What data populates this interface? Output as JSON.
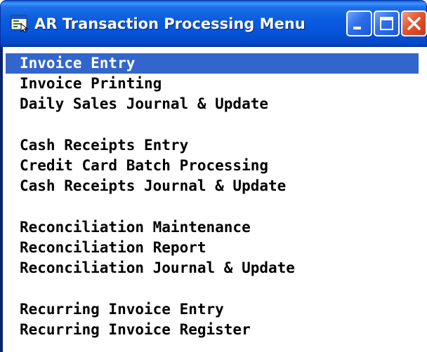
{
  "window": {
    "title": "AR Transaction Processing Menu",
    "icon": "terminal-app-icon",
    "controls": {
      "minimize_icon": "minimize-icon",
      "maximize_icon": "maximize-icon",
      "close_icon": "close-icon"
    }
  },
  "colors": {
    "titlebar": "#0553d8",
    "selection": "#3366cc",
    "close_button": "#e2562e"
  },
  "menu": {
    "selected_index": 0,
    "groups": [
      {
        "items": [
          {
            "label": "Invoice Entry"
          },
          {
            "label": "Invoice Printing"
          },
          {
            "label": "Daily Sales Journal & Update"
          }
        ]
      },
      {
        "items": [
          {
            "label": "Cash Receipts Entry"
          },
          {
            "label": "Credit Card Batch Processing"
          },
          {
            "label": "Cash Receipts Journal & Update"
          }
        ]
      },
      {
        "items": [
          {
            "label": "Reconciliation Maintenance"
          },
          {
            "label": "Reconciliation Report"
          },
          {
            "label": "Reconciliation Journal & Update"
          }
        ]
      },
      {
        "items": [
          {
            "label": "Recurring Invoice Entry"
          },
          {
            "label": "Recurring Invoice Register"
          }
        ]
      }
    ]
  }
}
